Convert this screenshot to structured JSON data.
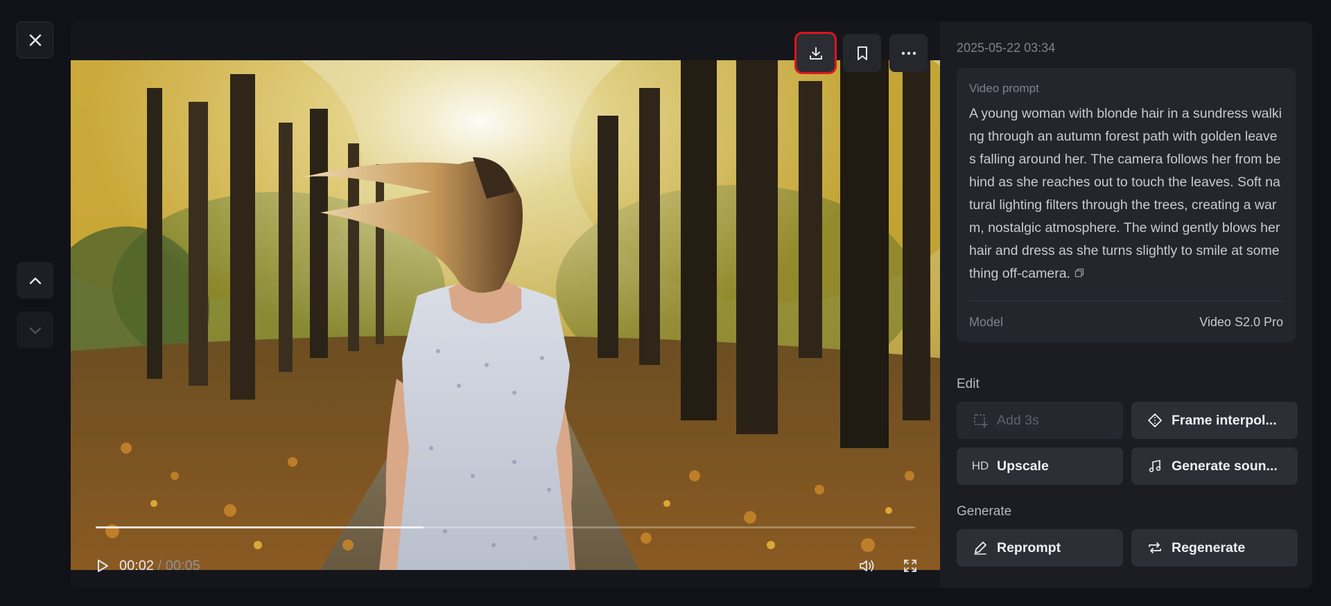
{
  "viewer": {
    "current_time": "00:02",
    "separator": " / ",
    "duration": "00:05",
    "progress_fraction": 0.4
  },
  "top_actions": [
    {
      "name": "download-button",
      "icon": "download-icon"
    },
    {
      "name": "bookmark-button",
      "icon": "bookmark-icon"
    },
    {
      "name": "more-button",
      "icon": "more-horizontal-icon"
    }
  ],
  "panel": {
    "date": "2025-05-22 03:34",
    "prompt_label": "Video prompt",
    "prompt_text": "A young woman with blonde hair in a sundress walking through an autumn forest path with golden leaves falling around her. The camera follows her from behind as she reaches out to touch the leaves. Soft natural lighting filters through the trees, creating a warm, nostalgic atmosphere. The wind gently blows her hair and dress as she turns slightly to smile at something off-camera.",
    "model_label": "Model",
    "model_value": "Video S2.0 Pro"
  },
  "edit": {
    "title": "Edit",
    "add3s": "Add 3s",
    "frame_interp": "Frame interpol...",
    "upscale_badge": "HD",
    "upscale": "Upscale",
    "generate_sound": "Generate soun..."
  },
  "generate": {
    "title": "Generate",
    "reprompt": "Reprompt",
    "regenerate": "Regenerate"
  },
  "colors": {
    "accent_highlight": "#e0141c",
    "panel_bg": "#1b1d23",
    "page_bg": "#111217"
  }
}
